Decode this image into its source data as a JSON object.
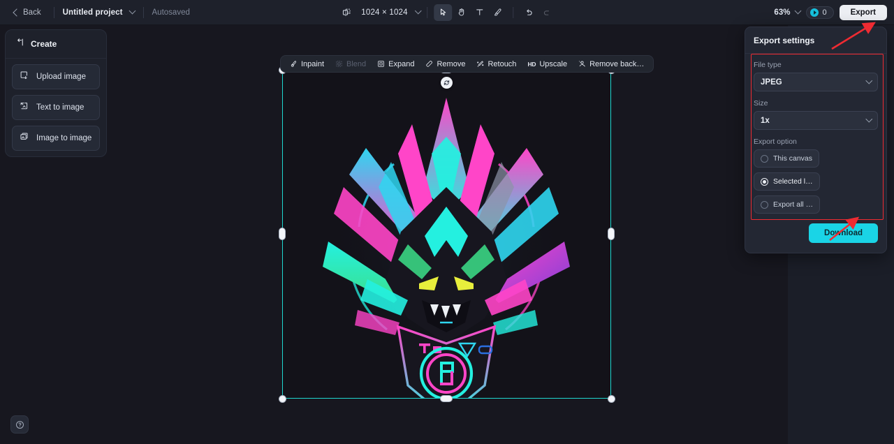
{
  "topbar": {
    "back_label": "Back",
    "project_name": "Untitled project",
    "autosaved_label": "Autosaved",
    "canvas_size": "1024 × 1024",
    "tools": [
      {
        "name": "frame-icon",
        "label": "Frame"
      },
      {
        "name": "select-tool",
        "label": "Select"
      },
      {
        "name": "hand-tool",
        "label": "Hand"
      },
      {
        "name": "text-tool",
        "label": "Text"
      },
      {
        "name": "brush-tool",
        "label": "Brush"
      },
      {
        "name": "undo-button",
        "label": "Undo"
      },
      {
        "name": "redo-button",
        "label": "Redo"
      }
    ],
    "zoom_level": "63%",
    "credits_count": "0",
    "export_label": "Export"
  },
  "sidebar": {
    "title": "Create",
    "collapse_icon": "collapse-panel-icon",
    "items": [
      {
        "label": "Upload image",
        "icon": "upload-image-icon"
      },
      {
        "label": "Text to image",
        "icon": "text-to-image-icon"
      },
      {
        "label": "Image to image",
        "icon": "image-to-image-icon"
      }
    ]
  },
  "canvas_toolbar": {
    "items": [
      {
        "label": "Inpaint",
        "icon": "inpaint-icon",
        "disabled": false
      },
      {
        "label": "Blend",
        "icon": "blend-icon",
        "disabled": true
      },
      {
        "label": "Expand",
        "icon": "expand-icon",
        "disabled": false
      },
      {
        "label": "Remove",
        "icon": "remove-icon",
        "disabled": false
      },
      {
        "label": "Retouch",
        "icon": "retouch-icon",
        "disabled": false
      },
      {
        "label": "Upscale",
        "icon": "hd-upscale-icon",
        "disabled": false
      },
      {
        "label": "Remove back…",
        "icon": "remove-background-icon",
        "disabled": false
      }
    ],
    "hd_badge": "HD"
  },
  "canvas": {
    "artwork_description": "Neon cyberpunk dragon mascot emblem",
    "selection_color": "#1fd8d0",
    "background_color": "#17171f",
    "artboard_color": "#131219",
    "artwork_colors": {
      "magenta": "#ff3fc4",
      "cyan": "#24f0e0",
      "blue": "#2b6fe0",
      "green": "#3ce08a",
      "yellow": "#e8ee3c",
      "dark": "#14131b"
    }
  },
  "export_panel": {
    "title": "Export settings",
    "file_type": {
      "label": "File type",
      "value": "JPEG"
    },
    "size": {
      "label": "Size",
      "value": "1x"
    },
    "export_option": {
      "label": "Export option",
      "options": [
        {
          "label": "This canvas",
          "checked": false
        },
        {
          "label": "Selected l…",
          "checked": true
        },
        {
          "label": "Export all …",
          "checked": false
        }
      ]
    },
    "download_label": "Download",
    "highlight_color": "#ef2b32"
  },
  "help": {
    "icon": "help-question-icon"
  }
}
